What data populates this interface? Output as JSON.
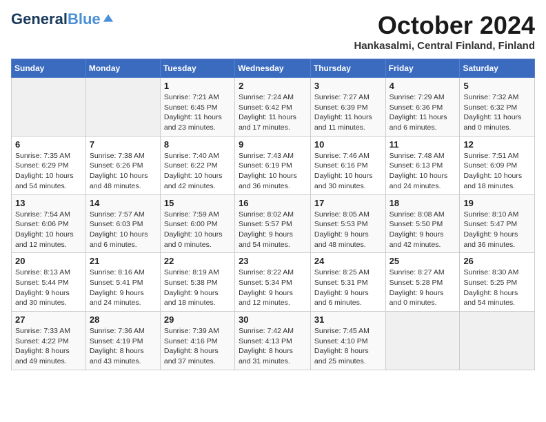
{
  "header": {
    "logo_line1": "General",
    "logo_line2": "Blue",
    "month": "October 2024",
    "location": "Hankasalmi, Central Finland, Finland"
  },
  "weekdays": [
    "Sunday",
    "Monday",
    "Tuesday",
    "Wednesday",
    "Thursday",
    "Friday",
    "Saturday"
  ],
  "weeks": [
    [
      null,
      null,
      {
        "day": 1,
        "sunrise": "7:21 AM",
        "sunset": "6:45 PM",
        "daylight": "11 hours and 23 minutes."
      },
      {
        "day": 2,
        "sunrise": "7:24 AM",
        "sunset": "6:42 PM",
        "daylight": "11 hours and 17 minutes."
      },
      {
        "day": 3,
        "sunrise": "7:27 AM",
        "sunset": "6:39 PM",
        "daylight": "11 hours and 11 minutes."
      },
      {
        "day": 4,
        "sunrise": "7:29 AM",
        "sunset": "6:36 PM",
        "daylight": "11 hours and 6 minutes."
      },
      {
        "day": 5,
        "sunrise": "7:32 AM",
        "sunset": "6:32 PM",
        "daylight": "11 hours and 0 minutes."
      }
    ],
    [
      {
        "day": 6,
        "sunrise": "7:35 AM",
        "sunset": "6:29 PM",
        "daylight": "10 hours and 54 minutes."
      },
      {
        "day": 7,
        "sunrise": "7:38 AM",
        "sunset": "6:26 PM",
        "daylight": "10 hours and 48 minutes."
      },
      {
        "day": 8,
        "sunrise": "7:40 AM",
        "sunset": "6:22 PM",
        "daylight": "10 hours and 42 minutes."
      },
      {
        "day": 9,
        "sunrise": "7:43 AM",
        "sunset": "6:19 PM",
        "daylight": "10 hours and 36 minutes."
      },
      {
        "day": 10,
        "sunrise": "7:46 AM",
        "sunset": "6:16 PM",
        "daylight": "10 hours and 30 minutes."
      },
      {
        "day": 11,
        "sunrise": "7:48 AM",
        "sunset": "6:13 PM",
        "daylight": "10 hours and 24 minutes."
      },
      {
        "day": 12,
        "sunrise": "7:51 AM",
        "sunset": "6:09 PM",
        "daylight": "10 hours and 18 minutes."
      }
    ],
    [
      {
        "day": 13,
        "sunrise": "7:54 AM",
        "sunset": "6:06 PM",
        "daylight": "10 hours and 12 minutes."
      },
      {
        "day": 14,
        "sunrise": "7:57 AM",
        "sunset": "6:03 PM",
        "daylight": "10 hours and 6 minutes."
      },
      {
        "day": 15,
        "sunrise": "7:59 AM",
        "sunset": "6:00 PM",
        "daylight": "10 hours and 0 minutes."
      },
      {
        "day": 16,
        "sunrise": "8:02 AM",
        "sunset": "5:57 PM",
        "daylight": "9 hours and 54 minutes."
      },
      {
        "day": 17,
        "sunrise": "8:05 AM",
        "sunset": "5:53 PM",
        "daylight": "9 hours and 48 minutes."
      },
      {
        "day": 18,
        "sunrise": "8:08 AM",
        "sunset": "5:50 PM",
        "daylight": "9 hours and 42 minutes."
      },
      {
        "day": 19,
        "sunrise": "8:10 AM",
        "sunset": "5:47 PM",
        "daylight": "9 hours and 36 minutes."
      }
    ],
    [
      {
        "day": 20,
        "sunrise": "8:13 AM",
        "sunset": "5:44 PM",
        "daylight": "9 hours and 30 minutes."
      },
      {
        "day": 21,
        "sunrise": "8:16 AM",
        "sunset": "5:41 PM",
        "daylight": "9 hours and 24 minutes."
      },
      {
        "day": 22,
        "sunrise": "8:19 AM",
        "sunset": "5:38 PM",
        "daylight": "9 hours and 18 minutes."
      },
      {
        "day": 23,
        "sunrise": "8:22 AM",
        "sunset": "5:34 PM",
        "daylight": "9 hours and 12 minutes."
      },
      {
        "day": 24,
        "sunrise": "8:25 AM",
        "sunset": "5:31 PM",
        "daylight": "9 hours and 6 minutes."
      },
      {
        "day": 25,
        "sunrise": "8:27 AM",
        "sunset": "5:28 PM",
        "daylight": "9 hours and 0 minutes."
      },
      {
        "day": 26,
        "sunrise": "8:30 AM",
        "sunset": "5:25 PM",
        "daylight": "8 hours and 54 minutes."
      }
    ],
    [
      {
        "day": 27,
        "sunrise": "7:33 AM",
        "sunset": "4:22 PM",
        "daylight": "8 hours and 49 minutes."
      },
      {
        "day": 28,
        "sunrise": "7:36 AM",
        "sunset": "4:19 PM",
        "daylight": "8 hours and 43 minutes."
      },
      {
        "day": 29,
        "sunrise": "7:39 AM",
        "sunset": "4:16 PM",
        "daylight": "8 hours and 37 minutes."
      },
      {
        "day": 30,
        "sunrise": "7:42 AM",
        "sunset": "4:13 PM",
        "daylight": "8 hours and 31 minutes."
      },
      {
        "day": 31,
        "sunrise": "7:45 AM",
        "sunset": "4:10 PM",
        "daylight": "8 hours and 25 minutes."
      },
      null,
      null
    ]
  ]
}
